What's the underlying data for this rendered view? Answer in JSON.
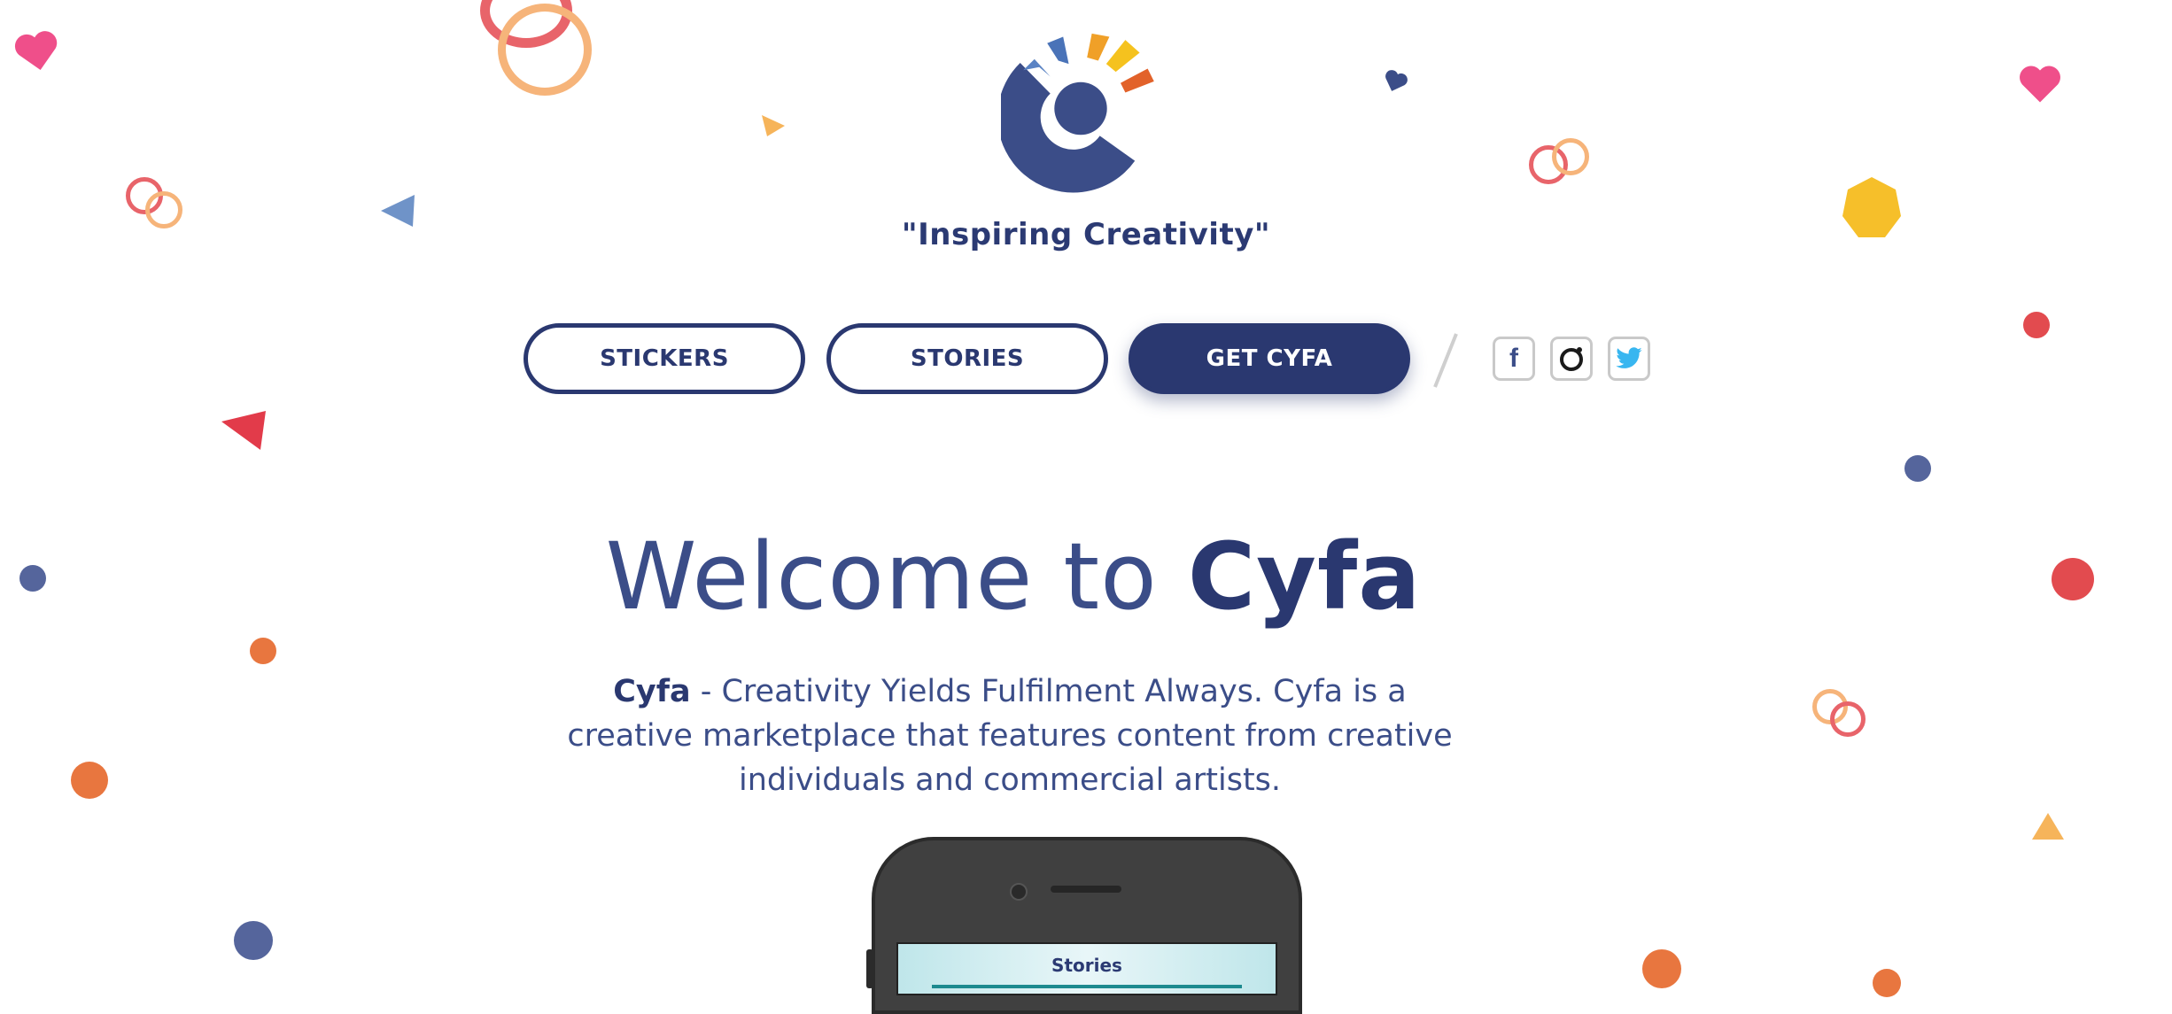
{
  "brand": {
    "tagline": "\"Inspiring Creativity\"",
    "logo_colors": [
      "#5a83c4",
      "#4a73b8",
      "#f0a028",
      "#f5c21e",
      "#e2622a",
      "#3b4d88"
    ]
  },
  "nav": {
    "stickers_label": "STICKERS",
    "stories_label": "STORIES",
    "get_label": "GET CYFA"
  },
  "social": {
    "facebook": "f",
    "instagram": "instagram-icon",
    "twitter": "twitter-icon"
  },
  "hero": {
    "title_prefix": "Welcome to ",
    "title_brand": "Cyfa",
    "desc_brand": "Cyfa",
    "desc_rest": " - Creativity Yields Fulfilment Always. Cyfa is a creative marketplace that features content from creative individuals and commercial artists."
  },
  "phone": {
    "screen_title": "Stories"
  },
  "colors": {
    "primary": "#2a3870",
    "text": "#3b4d88",
    "pink": "#ef4f8a",
    "orange": "#e8763f",
    "yellow": "#f6bf2a",
    "red": "#e24b4f",
    "navy_dot": "#55659c"
  }
}
